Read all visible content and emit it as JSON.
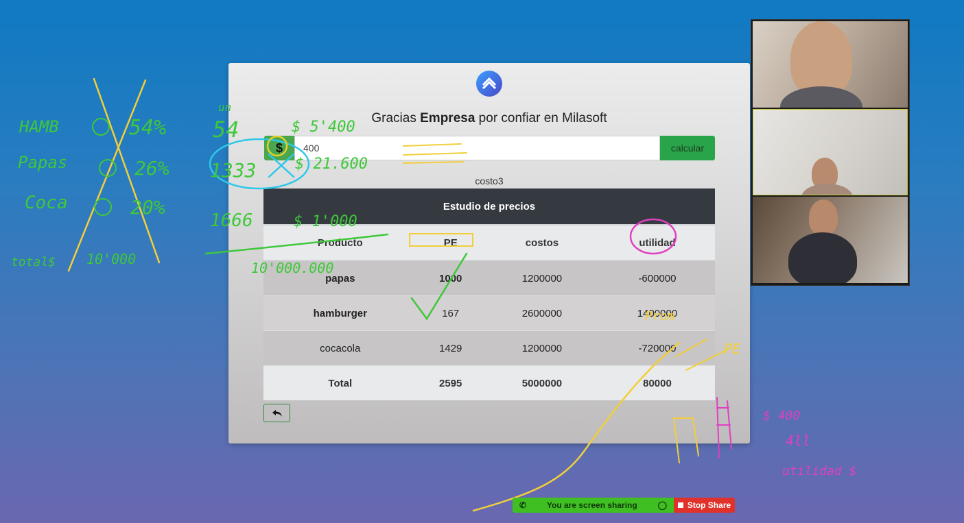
{
  "app": {
    "headline_pre": "Gracias ",
    "headline_bold": "Empresa",
    "headline_post": " por confiar en Milasoft"
  },
  "form": {
    "dollar_label": "$",
    "amount_value": "400",
    "calc_label": "calcular",
    "sublabel": "costo3"
  },
  "table": {
    "caption": "Estudio de precios",
    "columns": [
      "Producto",
      "PE",
      "costos",
      "utilidad"
    ],
    "rows": [
      {
        "producto": "papas",
        "pe": "1000",
        "costos": "1200000",
        "utilidad": "-600000"
      },
      {
        "producto": "hamburger",
        "pe": "167",
        "costos": "2600000",
        "utilidad": "1400000"
      },
      {
        "producto": "cocacola",
        "pe": "1429",
        "costos": "1200000",
        "utilidad": "-720000"
      }
    ],
    "total": {
      "label": "Total",
      "pe": "2595",
      "costos": "5000000",
      "utilidad": "80000"
    }
  },
  "sharing": {
    "status": "You are screen sharing",
    "stop": "Stop Share"
  },
  "annotations": {
    "green": [
      "HAMB",
      "54%",
      "Papas",
      "26%",
      "Coca",
      "20%",
      "total$",
      "10'000",
      "54",
      "1333",
      "1666",
      "$ 1'000",
      "10'000.000",
      "$ 5'400",
      "$ 21.600",
      "un"
    ],
    "pink": [
      "$ 400",
      "4ll",
      "utilidad $"
    ],
    "yellow": [
      "Prom",
      "PE"
    ]
  },
  "colors": {
    "accent_green": "#2aa44a",
    "table_header": "#353a40",
    "annot_green": "#3ec83a",
    "annot_yellow": "#f2cf3a",
    "annot_pink": "#e040c0",
    "annot_cyan": "#2ec8e8"
  }
}
